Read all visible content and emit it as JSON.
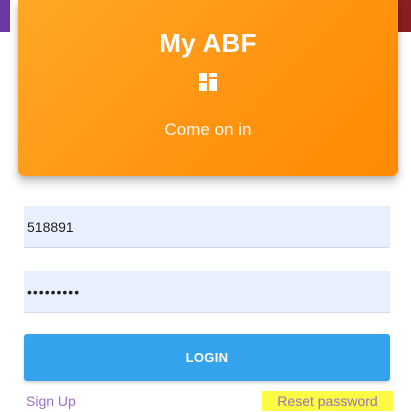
{
  "header": {
    "app_title": "My ABF",
    "logo_icon": "grid-logo-icon",
    "tagline": "Come on in",
    "accent_color": "#ff9512"
  },
  "login_form": {
    "username_value": "518891",
    "password_value": "•••••••••",
    "login_button_label": "LOGIN",
    "login_button_color": "#35a2ed"
  },
  "links": {
    "sign_up_label": "Sign Up",
    "reset_password_label": "Reset password",
    "highlight_color": "#fbfb43"
  }
}
